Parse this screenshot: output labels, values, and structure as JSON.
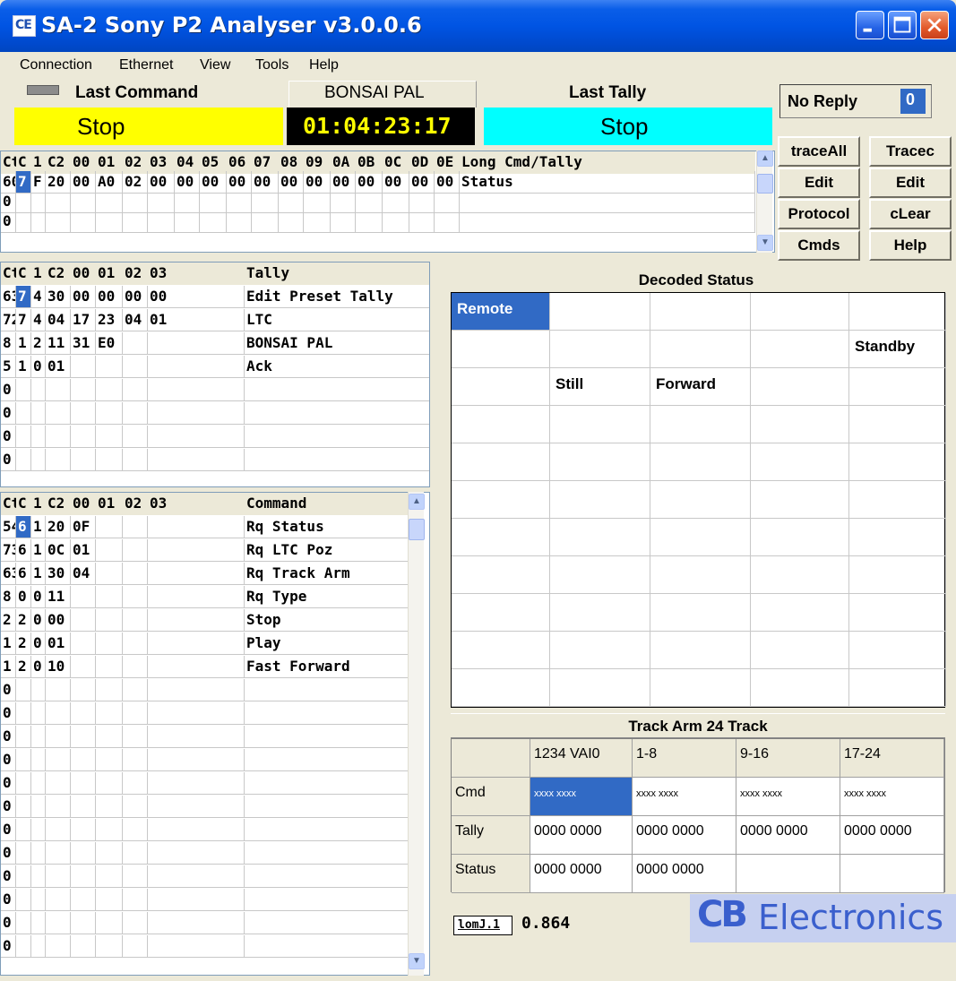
{
  "window": {
    "title": "SA-2 Sony P2 Analyser v3.0.0.6",
    "icon_glyph": "CE"
  },
  "menu": [
    "Connection",
    "Ethernet",
    "View",
    "Tools",
    "Help"
  ],
  "header": {
    "last_command_label": "Last Command",
    "last_command_value": "Stop",
    "device_name": "BONSAI PAL",
    "timecode": "01:04:23:17",
    "last_tally_label": "Last Tally",
    "last_tally_value": "Stop",
    "no_reply_label": "No Reply",
    "no_reply_count": "0"
  },
  "buttons": {
    "trace_all": "traceAll",
    "tracec": "Tracec",
    "edit_left": "Edit",
    "edit_right": "Edit",
    "protocol": "Protocol",
    "clear": "cLear",
    "cmds": "Cmds",
    "help": "Help"
  },
  "long_grid": {
    "headers": [
      "Ct",
      "C",
      "1",
      "C2",
      "00",
      "01",
      "02",
      "03",
      "04",
      "05",
      "06",
      "07",
      "08",
      "09",
      "0A",
      "0B",
      "0C",
      "0D",
      "0E",
      "Long Cmd/Tally"
    ],
    "rows": [
      [
        "60",
        "7",
        "F",
        "20",
        "00",
        "A0",
        "02",
        "00",
        "00",
        "00",
        "00",
        "00",
        "00",
        "00",
        "00",
        "00",
        "00",
        "00",
        "00",
        "Status"
      ],
      [
        "0",
        "",
        "",
        "",
        "",
        "",
        "",
        "",
        "",
        "",
        "",
        "",
        "",
        "",
        "",
        "",
        "",
        "",
        "",
        ""
      ],
      [
        "0",
        "",
        "",
        "",
        "",
        "",
        "",
        "",
        "",
        "",
        "",
        "",
        "",
        "",
        "",
        "",
        "",
        "",
        "",
        ""
      ]
    ]
  },
  "tally_grid": {
    "headers": [
      "Ct",
      "C",
      "1",
      "C2",
      "00",
      "01",
      "02",
      "03",
      "Tally"
    ],
    "rows": [
      [
        "63",
        "7",
        "4",
        "30",
        "00",
        "00",
        "00",
        "00",
        "Edit Preset Tally"
      ],
      [
        "72",
        "7",
        "4",
        "04",
        "17",
        "23",
        "04",
        "01",
        "LTC"
      ],
      [
        "8",
        "1",
        "2",
        "11",
        "31",
        "E0",
        "",
        "",
        "BONSAI PAL"
      ],
      [
        "5",
        "1",
        "0",
        "01",
        "",
        "",
        "",
        "",
        "Ack"
      ],
      [
        "0",
        "",
        "",
        "",
        "",
        "",
        "",
        "",
        ""
      ],
      [
        "0",
        "",
        "",
        "",
        "",
        "",
        "",
        "",
        ""
      ],
      [
        "0",
        "",
        "",
        "",
        "",
        "",
        "",
        "",
        ""
      ],
      [
        "0",
        "",
        "",
        "",
        "",
        "",
        "",
        "",
        ""
      ]
    ]
  },
  "command_grid": {
    "headers": [
      "Ct",
      "C",
      "1",
      "C2",
      "00",
      "01",
      "02",
      "03",
      "Command"
    ],
    "rows": [
      [
        "54",
        "6",
        "1",
        "20",
        "0F",
        "",
        "",
        "",
        "Rq Status"
      ],
      [
        "73",
        "6",
        "1",
        "0C",
        "01",
        "",
        "",
        "",
        "Rq LTC Poz"
      ],
      [
        "63",
        "6",
        "1",
        "30",
        "04",
        "",
        "",
        "",
        "Rq Track Arm"
      ],
      [
        "8",
        "0",
        "0",
        "11",
        "",
        "",
        "",
        "",
        "Rq Type"
      ],
      [
        "2",
        "2",
        "0",
        "00",
        "",
        "",
        "",
        "",
        "Stop"
      ],
      [
        "1",
        "2",
        "0",
        "01",
        "",
        "",
        "",
        "",
        "Play"
      ],
      [
        "1",
        "2",
        "0",
        "10",
        "",
        "",
        "",
        "",
        "Fast Forward"
      ],
      [
        "0",
        "",
        "",
        "",
        "",
        "",
        "",
        "",
        ""
      ],
      [
        "0",
        "",
        "",
        "",
        "",
        "",
        "",
        "",
        ""
      ],
      [
        "0",
        "",
        "",
        "",
        "",
        "",
        "",
        "",
        ""
      ],
      [
        "0",
        "",
        "",
        "",
        "",
        "",
        "",
        "",
        ""
      ],
      [
        "0",
        "",
        "",
        "",
        "",
        "",
        "",
        "",
        ""
      ],
      [
        "0",
        "",
        "",
        "",
        "",
        "",
        "",
        "",
        ""
      ],
      [
        "0",
        "",
        "",
        "",
        "",
        "",
        "",
        "",
        ""
      ],
      [
        "0",
        "",
        "",
        "",
        "",
        "",
        "",
        "",
        ""
      ],
      [
        "0",
        "",
        "",
        "",
        "",
        "",
        "",
        "",
        ""
      ],
      [
        "0",
        "",
        "",
        "",
        "",
        "",
        "",
        "",
        ""
      ],
      [
        "0",
        "",
        "",
        "",
        "",
        "",
        "",
        "",
        ""
      ],
      [
        "0",
        "",
        "",
        "",
        "",
        "",
        "",
        "",
        ""
      ]
    ]
  },
  "decoded_status": {
    "title": "Decoded Status",
    "cells": [
      [
        "Remote",
        "",
        "",
        "",
        ""
      ],
      [
        "",
        "",
        "",
        "",
        "Standby"
      ],
      [
        "",
        "Still",
        "Forward",
        "",
        ""
      ],
      [
        "",
        "",
        "",
        "",
        ""
      ],
      [
        "",
        "",
        "",
        "",
        ""
      ],
      [
        "",
        "",
        "",
        "",
        ""
      ],
      [
        "",
        "",
        "",
        "",
        ""
      ],
      [
        "",
        "",
        "",
        "",
        ""
      ],
      [
        "",
        "",
        "",
        "",
        ""
      ],
      [
        "",
        "",
        "",
        "",
        ""
      ],
      [
        "",
        "",
        "",
        "",
        ""
      ]
    ]
  },
  "track_arm": {
    "title": "Track Arm 24 Track",
    "columns": [
      "",
      "1234 VAI0",
      "1-8",
      "9-16",
      "17-24"
    ],
    "rows": [
      [
        "Cmd",
        "xxxx xxxx",
        "xxxx xxxx",
        "xxxx xxxx",
        "xxxx xxxx"
      ],
      [
        "Tally",
        "0000 0000",
        "0000 0000",
        "0000 0000",
        "0000 0000"
      ],
      [
        "Status",
        "0000 0000",
        "0000 0000",
        "",
        ""
      ]
    ]
  },
  "footer": {
    "meter_label": "lomJ.1",
    "meter_value": "0.864",
    "logo_mark": "CB",
    "logo_text": "Electronics"
  },
  "colors": {
    "yellow": "#ffff00",
    "cyan": "#00ffff",
    "timecode_bg": "#000000",
    "timecode_fg": "#ffff00",
    "selection": "#316ac5",
    "logo": "#3a5fcd"
  }
}
